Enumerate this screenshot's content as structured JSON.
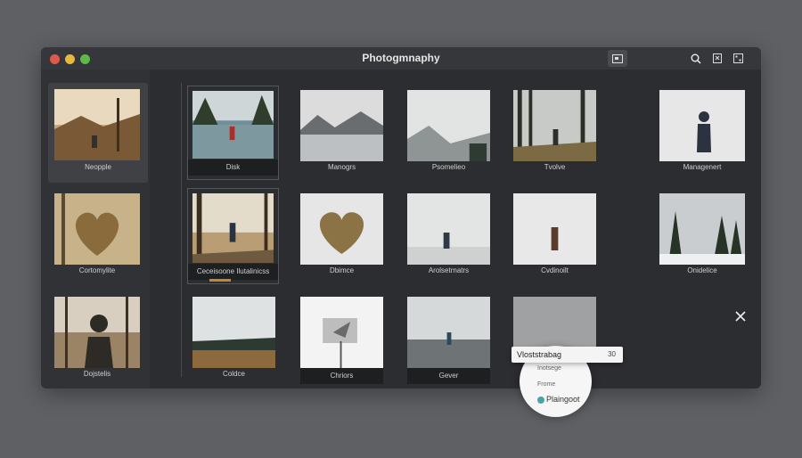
{
  "window": {
    "title": "Photogmnaphy"
  },
  "traffic_lights": {
    "red": "#e0584d",
    "yellow": "#e9b83a",
    "green": "#5fb94a"
  },
  "toolbar": {
    "icons": [
      "layout-icon",
      "search-icon",
      "crop-icon",
      "grid-icon"
    ]
  },
  "sidebar": {
    "items": [
      {
        "label": "Neopple"
      },
      {
        "label": "Cortomylite"
      },
      {
        "label": "Dojstelis"
      }
    ]
  },
  "grid": {
    "rows": [
      [
        {
          "label": "Disk"
        },
        {
          "label": "Manogrs"
        },
        {
          "label": "Psomelieo"
        },
        {
          "label": "Tvolve"
        },
        {
          "label": "Managenert"
        }
      ],
      [
        {
          "label": "Ceceisoone Ilutalinicss"
        },
        {
          "label": "Dbimce"
        },
        {
          "label": "Arolsetrnatrs"
        },
        {
          "label": "Cvdinoilt"
        },
        {
          "label": "Onidelice"
        }
      ],
      [
        {
          "label": "Coldce"
        },
        {
          "label": "Chriors"
        },
        {
          "label": "Gever"
        }
      ]
    ]
  },
  "context_menu": {
    "label": "Vloststrabag",
    "value": "30"
  },
  "popup": {
    "items": [
      "Inotsege",
      "Frome",
      "Plaingoot"
    ]
  }
}
